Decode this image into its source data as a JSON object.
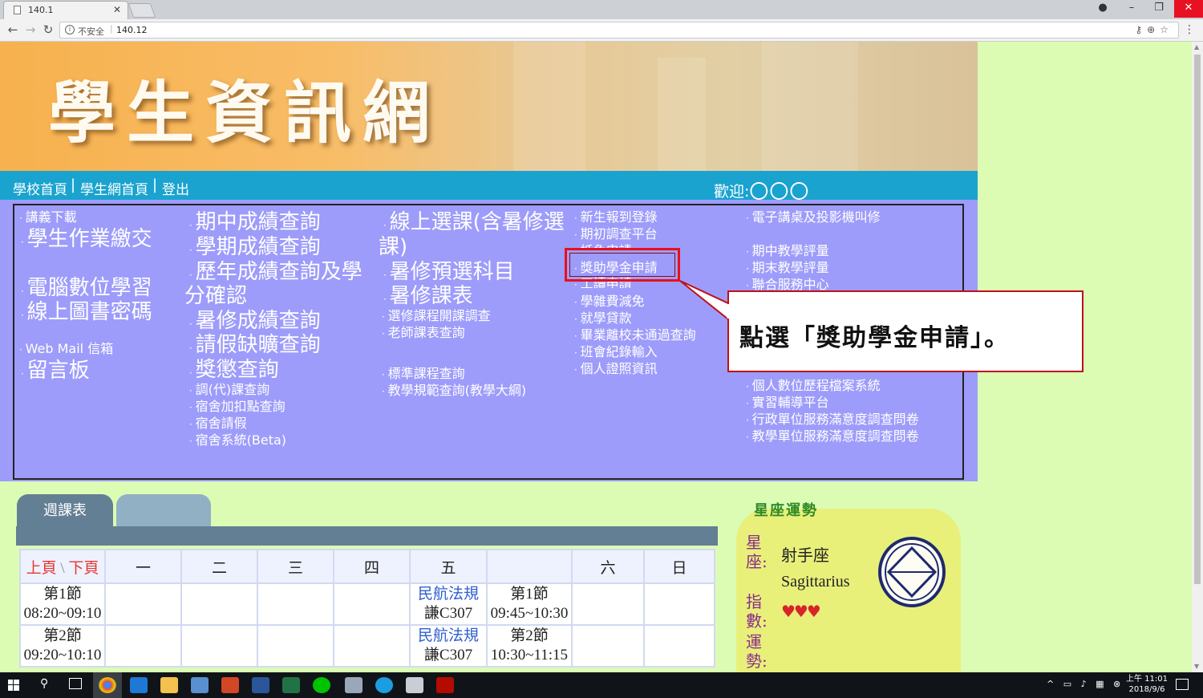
{
  "browser": {
    "tab_title": "140.1",
    "insecure_label": "不安全",
    "url": "140.12"
  },
  "banner": {
    "title": "學生資訊網"
  },
  "navbar": {
    "links": [
      "學校首頁",
      "學生網首頁",
      "登出"
    ],
    "welcome_label": "歡迎:",
    "user_name": "〇〇〇"
  },
  "menu": {
    "col1": [
      "講義下載",
      "學生作業繳交",
      "電腦數位學習",
      "線上圖書密碼",
      "Web Mail 信箱",
      "留言板"
    ],
    "col2": [
      "期中成績查詢",
      "學期成績查詢",
      "歷年成績查詢及學",
      "分確認",
      "暑修成績查詢",
      "請假缺曠查詢",
      "獎懲查詢",
      "調(代)課查詢",
      "宿舍加扣點查詢",
      "宿舍請假",
      "宿舍系統(Beta)"
    ],
    "col3": [
      "線上選課(含暑修選",
      "課)",
      "暑修預選科目",
      "暑修課表",
      "選修課程開課調查",
      "老師課表查詢",
      "標準課程查詢",
      "教學規範查詢(教學大綱)"
    ],
    "col4": [
      "新生報到登錄",
      "期初調查平台",
      "抵免申請",
      "獎助學金申請",
      "工讀申請",
      "學雜費減免",
      "就學貸款",
      "畢業離校未通過查詢",
      "班會紀錄輸入",
      "個人證照資訊"
    ],
    "col5": [
      "電子講桌及投影機叫修",
      "期中教學評量",
      "期末教學評量",
      "聯合服務中心",
      "個人數位歷程檔案系統",
      "實習輔導平台",
      "行政單位服務滿意度調查問卷",
      "教學單位服務滿意度調查問卷"
    ]
  },
  "callout": {
    "text": "點選「獎助學金申請」。"
  },
  "schedule": {
    "tab_label": "週課表",
    "prev_label": "上頁",
    "next_label": "下頁",
    "days": [
      "一",
      "二",
      "三",
      "四",
      "五",
      "",
      "六",
      "日"
    ],
    "rows": [
      {
        "period": "第1節",
        "time": "08:20~09:10",
        "course": "民航法規",
        "room": "謙C307",
        "period2": "第1節",
        "time2": "09:45~10:30"
      },
      {
        "period": "第2節",
        "time": "09:20~10:10",
        "course": "民航法規",
        "room": "謙C307",
        "period2": "第2節",
        "time2": "10:30~11:15"
      }
    ]
  },
  "horoscope": {
    "title": "星座運勢",
    "sign_label": "星座:",
    "sign_zh": "射手座",
    "sign_en": "Sagittarius",
    "index_label": "指數:",
    "luck_label": "運勢:",
    "hearts": "♥♥♥"
  },
  "taskbar": {
    "time": "上午 11:01",
    "date": "2018/9/6"
  },
  "colors": {
    "menu_bg": "#9d9cfb",
    "navbar": "#1aa3cf",
    "highlight": "#e8101a",
    "page_bg": "#dcfcb4"
  }
}
